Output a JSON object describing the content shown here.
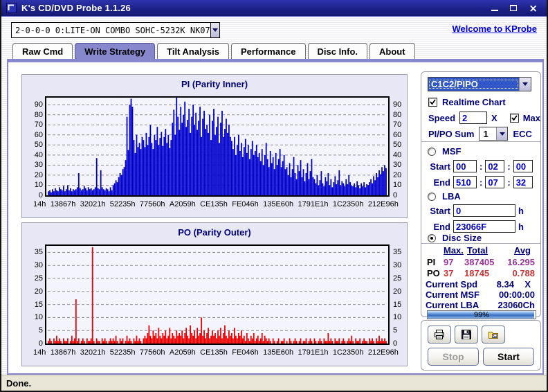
{
  "window": {
    "title": "K's CD/DVD Probe 1.1.26"
  },
  "toolbar": {
    "drive_combo_value": "2-0-0-0 0:LITE-ON COMBO SOHC-5232K NK07",
    "welcome_link": "Welcome to KProbe"
  },
  "tabs": [
    {
      "label": "Raw Cmd"
    },
    {
      "label": "Write Strategy"
    },
    {
      "label": "Tilt Analysis"
    },
    {
      "label": "Performance"
    },
    {
      "label": "Disc Info."
    },
    {
      "label": "About"
    }
  ],
  "controls": {
    "mode_combo_value": "C1C2/PIPO",
    "realtime_chart_label": "Realtime Chart",
    "speed_label": "Speed",
    "speed_value": "2",
    "speed_unit": "X",
    "max_label": "Max",
    "pipo_sum_label": "PI/PO Sum",
    "pipo_sum_value": "1",
    "ecc_label": "ECC",
    "msf_label": "MSF",
    "lba_label": "LBA",
    "disc_size_label": "Disc Size",
    "start_label": "Start",
    "end_label": "End",
    "colon": ":",
    "msf_start": [
      "00",
      "02",
      "00"
    ],
    "msf_end": [
      "510",
      "07",
      "32"
    ],
    "lba_start": "0",
    "lba_end": "23066F",
    "hex_suffix": "h"
  },
  "stats": {
    "headers": [
      "Max.",
      "Total",
      "Avg"
    ],
    "rows": [
      {
        "label": "PI",
        "max": "97",
        "total": "387405",
        "avg": "16.295"
      },
      {
        "label": "PO",
        "max": "37",
        "total": "18745",
        "avg": "0.788"
      }
    ],
    "current_spd_label": "Current Spd",
    "current_spd_value": "8.34",
    "current_spd_unit": "X",
    "current_msf_label": "Current MSF",
    "current_msf_value": "00:00:00",
    "current_lba_label": "Current LBA",
    "current_lba_value": "23060Ch",
    "progress_percent": 99,
    "progress_label": "99%"
  },
  "buttons": {
    "stop": "Stop",
    "start": "Start"
  },
  "statusbar": {
    "text": "Done."
  },
  "colors": {
    "accent_purple": "#8787CE",
    "navy_label": "#00007E",
    "pi_blue": "#0000CE",
    "po_red": "#EE0000",
    "stat_pi_purple": "#993399",
    "stat_po_red": "#CC3333",
    "titlebar_navy": "#1D2289",
    "status_beige": "#E9E5D7"
  },
  "chart_data": [
    {
      "type": "bar",
      "title": "PI (Parity Inner)",
      "color": "#0000CE",
      "ylim": [
        0,
        97
      ],
      "y_ticks": [
        0,
        10,
        20,
        30,
        40,
        50,
        60,
        70,
        80,
        90
      ],
      "grid": "dashed horizontal",
      "x_labels": [
        "14h",
        "13867h",
        "32021h",
        "52235h",
        "77560h",
        "A2059h",
        "CE135h",
        "FE046h",
        "135E60h",
        "1791E1h",
        "1C2350h",
        "212E96h"
      ],
      "values": [
        4,
        5,
        3,
        6,
        4,
        7,
        5,
        4,
        8,
        6,
        5,
        9,
        4,
        6,
        10,
        5,
        7,
        4,
        6,
        5,
        6,
        8,
        22,
        7,
        5,
        6,
        9,
        7,
        5,
        8,
        6,
        7,
        5,
        6,
        8,
        37,
        7,
        6,
        25,
        8,
        6,
        5,
        7,
        6,
        4,
        8,
        5,
        10,
        12,
        15,
        13,
        18,
        22,
        20,
        26,
        28,
        35,
        78,
        45,
        90,
        96,
        88,
        55,
        42,
        60,
        48,
        52,
        46,
        58,
        55,
        48,
        62,
        50,
        58,
        70,
        52,
        46,
        60,
        55,
        68,
        50,
        57,
        63,
        49,
        58,
        66,
        52,
        60,
        47,
        55,
        72,
        85,
        60,
        97,
        78,
        65,
        88,
        72,
        80,
        93,
        68,
        75,
        86,
        62,
        78,
        90,
        70,
        82,
        65,
        74,
        88,
        58,
        76,
        84,
        66,
        70,
        62,
        80,
        55,
        74,
        86,
        60,
        68,
        78,
        52,
        72,
        84,
        58,
        66,
        76,
        62,
        70,
        58,
        54,
        46,
        58,
        40,
        50,
        60,
        44,
        52,
        38,
        48,
        56,
        42,
        50,
        36,
        46,
        54,
        40,
        44,
        50,
        38,
        42,
        34,
        46,
        30,
        40,
        52,
        36,
        28,
        44,
        32,
        38,
        26,
        42,
        30,
        36,
        46,
        28,
        34,
        40,
        26,
        28,
        20,
        32,
        18,
        26,
        38,
        22,
        16,
        30,
        24,
        35,
        18,
        26,
        14,
        22,
        32,
        16,
        24,
        36,
        18,
        16,
        12,
        20,
        10,
        15,
        24,
        12,
        9,
        18,
        14,
        22,
        10,
        16,
        8,
        13,
        19,
        11,
        15,
        25,
        10,
        14,
        12,
        9,
        16,
        11,
        20,
        13,
        10,
        9,
        12,
        8,
        14,
        10,
        7,
        12,
        9,
        13,
        8,
        11,
        10,
        13,
        16,
        12,
        19,
        15,
        22,
        18,
        25,
        21,
        28,
        24,
        30,
        27
      ]
    },
    {
      "type": "bar",
      "title": "PO (Parity Outer)",
      "color": "#EE0000",
      "ylim": [
        0,
        37.5
      ],
      "y_ticks": [
        0,
        5,
        10,
        15,
        20,
        25,
        30,
        35
      ],
      "grid": "dashed horizontal",
      "x_labels": [
        "14h",
        "13867h",
        "32021h",
        "52235h",
        "77560h",
        "A2059h",
        "CE135h",
        "FE046h",
        "135E60h",
        "1791E1h",
        "1C2350h",
        "212E96h"
      ],
      "values": [
        1,
        2,
        1,
        0,
        2,
        1,
        3,
        1,
        2,
        1,
        0,
        2,
        1,
        1,
        2,
        0,
        1,
        3,
        1,
        2,
        17,
        1,
        2,
        0,
        1,
        2,
        1,
        0,
        2,
        1,
        1,
        2,
        37,
        1,
        0,
        2,
        1,
        1,
        0,
        2,
        1,
        2,
        1,
        0,
        1,
        2,
        1,
        2,
        1,
        3,
        1,
        0,
        2,
        1,
        2,
        0,
        1,
        3,
        1,
        2,
        1,
        0,
        2,
        1,
        3,
        1,
        2,
        1,
        0,
        2,
        3,
        2,
        4,
        7,
        3,
        2,
        5,
        3,
        4,
        2,
        6,
        3,
        2,
        4,
        3,
        5,
        2,
        3,
        6,
        2,
        4,
        3,
        2,
        5,
        3,
        4,
        3,
        5,
        2,
        4,
        6,
        3,
        2,
        7,
        4,
        3,
        5,
        2,
        6,
        3,
        4,
        10,
        3,
        5,
        2,
        4,
        6,
        2,
        3,
        5,
        3,
        4,
        2,
        5,
        3,
        6,
        2,
        4,
        7,
        3,
        2,
        5,
        3,
        4,
        2,
        6,
        3,
        2,
        4,
        3,
        5,
        2,
        3,
        1,
        4,
        2,
        1,
        3,
        2,
        4,
        1,
        2,
        3,
        1,
        2,
        4,
        1,
        3,
        2,
        1,
        2,
        1,
        0,
        2,
        1,
        0,
        1,
        2,
        0,
        1,
        1,
        2,
        0,
        1,
        0,
        2,
        1,
        0,
        1,
        2,
        1,
        0,
        1,
        2,
        0,
        1,
        1,
        2,
        0,
        1,
        2,
        1,
        0,
        2,
        1,
        0,
        1,
        2,
        1,
        0,
        2,
        1,
        1,
        4,
        1,
        2,
        1,
        0,
        2,
        1,
        1,
        2,
        0,
        1,
        2,
        1,
        0,
        1,
        2,
        1,
        3,
        1,
        0,
        2,
        1,
        1,
        2,
        0,
        1,
        2,
        1,
        1,
        0,
        2,
        1,
        2,
        1,
        0,
        2,
        1,
        3,
        1,
        2,
        1,
        2,
        1
      ]
    }
  ]
}
